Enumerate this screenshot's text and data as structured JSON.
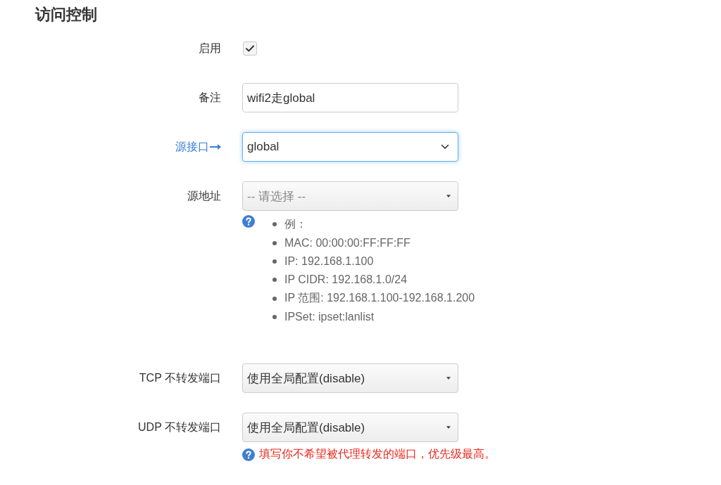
{
  "section_title": "访问控制",
  "fields": [
    {
      "kind": "checkbox",
      "label": "启用",
      "checked": true
    },
    {
      "kind": "text",
      "label": "备注",
      "value": "wifi2走global"
    },
    {
      "kind": "select",
      "label": "源接口",
      "link": true,
      "focused": true,
      "value": "global"
    },
    {
      "kind": "dropdown",
      "label": "源地址",
      "placeholder": "-- 请选择 --",
      "help": [
        "例：",
        "MAC: 00:00:00:FF:FF:FF",
        "IP: 192.168.1.100",
        "IP CIDR: 192.168.1.0/24",
        "IP 范围: 192.168.1.100-192.168.1.200",
        "IPSet: ipset:lanlist"
      ]
    },
    {
      "kind": "dropdown",
      "label": "TCP 不转发端口",
      "value": "使用全局配置(disable)"
    },
    {
      "kind": "dropdown",
      "label": "UDP 不转发端口",
      "value": "使用全局配置(disable)",
      "note": "填写你不希望被代理转发的端口，优先级最高。"
    }
  ]
}
